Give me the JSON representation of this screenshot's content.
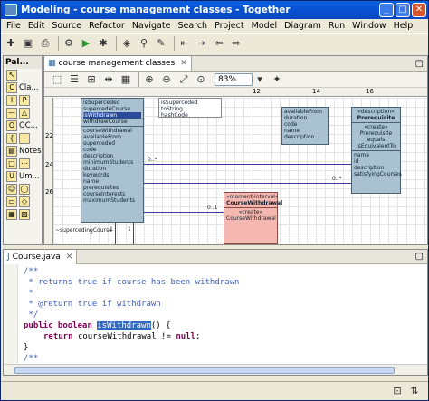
{
  "window": {
    "title": "Modeling - course management classes - Together",
    "minimize": "_",
    "maximize": "□",
    "close": "✕"
  },
  "menu": [
    "File",
    "Edit",
    "Source",
    "Refactor",
    "Navigate",
    "Search",
    "Project",
    "Model",
    "Diagram",
    "Run",
    "Window",
    "Help"
  ],
  "palette": {
    "header": "Pal...",
    "items": [
      "Cla...",
      "OC...",
      "Notes",
      "Um..."
    ]
  },
  "diagram": {
    "tab_label": "course management classes",
    "zoom": "83%",
    "ruler_marks": [
      "12",
      "14",
      "16"
    ],
    "vruler_marks": [
      "22",
      "24",
      "26"
    ],
    "class_left_rows_top": [
      "isSuperceded",
      "supercedeCourse",
      "isWithdrawn",
      "withdrawCourse"
    ],
    "class_left_rows_attrs": [
      "courseWithdrawal",
      "availableFrom",
      "superceded",
      "code",
      "description",
      "minimumStudents",
      "duration",
      "keywords",
      "name",
      "prerequisites",
      "courseInterests",
      "maximumStudents"
    ],
    "class_left_footer": "~supercedingCourse",
    "class_white_rows": [
      "isSuperceded",
      "toString",
      "hashCode"
    ],
    "class_mid_rows": [
      "availableFrom",
      "duration",
      "code",
      "name",
      "description"
    ],
    "class_right_stereotype": "«description»",
    "class_right_name": "Prerequisite",
    "class_right_rows": [
      "«create»",
      "Prerequisite",
      "equals",
      "isEquivalentTo"
    ],
    "class_right_attrs": [
      "name",
      "id",
      "description",
      "satisfyingCourses"
    ],
    "class_pink_stereotype": "«moment-interval»",
    "class_pink_name": "CourseWithdrawal",
    "class_pink_rows": [
      "«create»",
      "CourseWithdrawal"
    ],
    "mult_1": "0..*",
    "mult_2": "0..*",
    "mult_3": "0..1",
    "mult_4": "1",
    "mult_5": "1"
  },
  "code": {
    "tab_label": "Course.java",
    "lines": [
      "/**",
      " * returns true if course has been withdrawn",
      " *",
      " * @return true if withdrawn",
      " */"
    ],
    "sig_kw": "public boolean ",
    "sig_name": "isWithdrawn",
    "sig_rest": "() {",
    "ret_kw": "return ",
    "ret_expr": "courseWithdrawal != ",
    "ret_null": "null",
    "ret_end": ";",
    "close": "}",
    "next": "/**"
  }
}
